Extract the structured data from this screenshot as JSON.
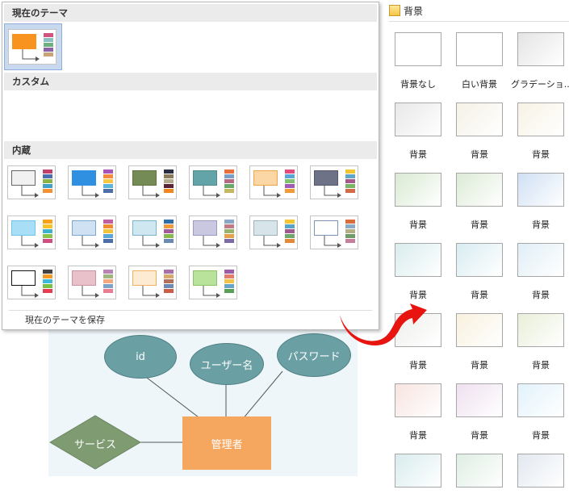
{
  "theme_panel": {
    "current_header": "現在のテーマ",
    "custom_header": "カスタム",
    "builtin_header": "内蔵",
    "save_label": "現在のテーマを保存",
    "current_theme": {
      "fill": "#f7931e",
      "stroke": "#f7931e",
      "stripes": [
        "#d0547f",
        "#8cbfc2",
        "#6fb07f",
        "#8d63a8",
        "#c9a275"
      ]
    },
    "builtin_themes": [
      {
        "fill": "#f1f1f1",
        "stroke": "#666666",
        "stripes": [
          "#c0416b",
          "#4a6fb0",
          "#8ab446",
          "#3fa0c8",
          "#f39234"
        ]
      },
      {
        "fill": "#2f8fe0",
        "stroke": "#2f8fe0",
        "stripes": [
          "#a855b8",
          "#f28c3c",
          "#f7c746",
          "#5bb6d9",
          "#4c6fa8"
        ]
      },
      {
        "fill": "#748b55",
        "stroke": "#5f7240",
        "stripes": [
          "#2d2d44",
          "#8b7b59",
          "#b4a98b",
          "#5a2436",
          "#f2871f"
        ]
      },
      {
        "fill": "#62a4a8",
        "stroke": "#4f8a8e",
        "stripes": [
          "#e8703c",
          "#7a9fc8",
          "#b36c83",
          "#6aa96a",
          "#c5b764"
        ]
      },
      {
        "fill": "#fbd7a6",
        "stroke": "#f2a64b",
        "stripes": [
          "#e44b7b",
          "#5aa6d8",
          "#7fc16d",
          "#a05bb4",
          "#f19a38"
        ]
      },
      {
        "fill": "#6e7286",
        "stroke": "#55586b",
        "stripes": [
          "#f1c533",
          "#5ea7c9",
          "#a45a8d",
          "#7bb466",
          "#d16b48"
        ]
      },
      {
        "fill": "#a9dff6",
        "stroke": "#6fc3e8",
        "stripes": [
          "#f7a21b",
          "#f8c22a",
          "#3db3c9",
          "#8bc34a",
          "#d04e83"
        ]
      },
      {
        "fill": "#cfe1f3",
        "stroke": "#7ea7cf",
        "stripes": [
          "#c05fa0",
          "#f08a33",
          "#f0c33c",
          "#5ba6d6",
          "#4c6fa8"
        ]
      },
      {
        "fill": "#cfe7f0",
        "stroke": "#7fb3c8",
        "stripes": [
          "#2f6fa8",
          "#f39a3a",
          "#a55a9a",
          "#88b94c",
          "#6b89b4"
        ]
      },
      {
        "fill": "#c9c8e0",
        "stroke": "#9a99c0",
        "stripes": [
          "#8aa7c8",
          "#c07b86",
          "#9ab36a",
          "#e4a24d",
          "#7d6aa9"
        ]
      },
      {
        "fill": "#d7e4ea",
        "stroke": "#9ab2be",
        "stripes": [
          "#f2c531",
          "#5aa4c9",
          "#a05a8d",
          "#6ea86c",
          "#e4883a"
        ]
      },
      {
        "fill": "#ffffff",
        "stroke": "#7b94b5",
        "stripes": [
          "#d96d3d",
          "#8ca9c6",
          "#b4ae86",
          "#6f9b6b",
          "#c57f9c"
        ]
      },
      {
        "fill": "#ffffff",
        "stroke": "#111111",
        "stripes": [
          "#444444",
          "#f59b23",
          "#3fb9d8",
          "#7ac143",
          "#e53d51"
        ]
      },
      {
        "fill": "#e9c1cb",
        "stroke": "#c9949f",
        "stripes": [
          "#b884b4",
          "#9fb67e",
          "#f3a97d",
          "#7ea2c8",
          "#e87d93"
        ]
      },
      {
        "fill": "#fdebd4",
        "stroke": "#f0b062",
        "stripes": [
          "#a86fa8",
          "#d9a96b",
          "#b1735e",
          "#6b8bb5",
          "#c95d47"
        ]
      },
      {
        "fill": "#b9e29a",
        "stroke": "#8bc464",
        "stripes": [
          "#9b5fa7",
          "#e47e6c",
          "#f3c24a",
          "#69a4c9",
          "#5a9f58"
        ]
      }
    ]
  },
  "backgrounds": {
    "header_title": "背景",
    "tiles": [
      {
        "label": "背景なし",
        "color": "#ffffff"
      },
      {
        "label": "白い背景",
        "color": "#ffffff"
      },
      {
        "label": "グラデーショ...",
        "color": "#e4e4e4"
      },
      {
        "label": "背景",
        "color": "#e8e8e8"
      },
      {
        "label": "背景",
        "color": "#f5f1e6"
      },
      {
        "label": "背景",
        "color": "#f7f2e4"
      },
      {
        "label": "背景",
        "color": "#d9ead2"
      },
      {
        "label": "背景",
        "color": "#dcebd6"
      },
      {
        "label": "背景",
        "color": "#cfe0f3"
      },
      {
        "label": "背景",
        "color": "#d9ecee"
      },
      {
        "label": "背景",
        "color": "#d8ecf1"
      },
      {
        "label": "背景",
        "color": "#e0eef6"
      },
      {
        "label": "背景",
        "color": "#eef0ec"
      },
      {
        "label": "背景",
        "color": "#f8f1df"
      },
      {
        "label": "背景",
        "color": "#e8efd8"
      },
      {
        "label": "背景",
        "color": "#f7e4e0"
      },
      {
        "label": "背景",
        "color": "#efe0ef"
      },
      {
        "label": "背景",
        "color": "#e2f2fb"
      },
      {
        "label": "",
        "color": "#d8ecee"
      },
      {
        "label": "",
        "color": "#dfeee3"
      },
      {
        "label": "",
        "color": "#e2e8f0"
      }
    ]
  },
  "diagram": {
    "entity": "管理者",
    "attributes": [
      "id",
      "ユーザー名",
      "パスワード"
    ],
    "relationship": "サービス",
    "colors": {
      "attribute": "#6a9fa3",
      "entity": "#f5a75f",
      "relationship": "#7e9b72"
    }
  }
}
